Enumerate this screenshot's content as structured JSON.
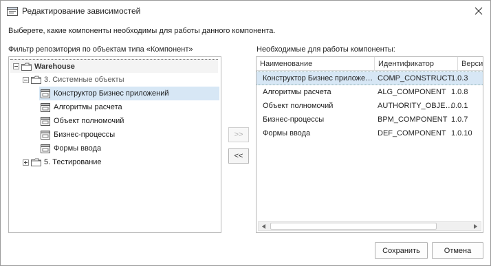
{
  "window": {
    "title": "Редактирование зависимостей",
    "instruction": "Выберете, какие компоненты необходимы для работы данного компонента."
  },
  "left_panel": {
    "label": "Фильтр репозитория по объектам типа «Компонент»",
    "tree": [
      {
        "label": "Warehouse",
        "kind": "root-folder",
        "expanded": true
      },
      {
        "label": "3. Системные объекты",
        "kind": "folder",
        "expanded": true
      },
      {
        "label": "Конструктор Бизнес приложений",
        "kind": "component",
        "selected": true
      },
      {
        "label": "Алгоритмы расчета",
        "kind": "component"
      },
      {
        "label": "Объект полномочий",
        "kind": "component"
      },
      {
        "label": "Бизнес-процессы",
        "kind": "component"
      },
      {
        "label": "Формы ввода",
        "kind": "component"
      },
      {
        "label": "5. Тестирование",
        "kind": "folder",
        "expanded": false
      }
    ]
  },
  "middle": {
    "add_label": ">>",
    "remove_label": "<<"
  },
  "right_panel": {
    "label": "Необходимые для работы компоненты:",
    "columns": [
      "Наименование",
      "Идентификатор",
      "Версия"
    ],
    "rows": [
      {
        "name": "Конструктор Бизнес приложений",
        "id": "COMP_CONSTRUCT",
        "version": "1.0.3",
        "selected": true
      },
      {
        "name": "Алгоритмы расчета",
        "id": "ALG_COMPONENT",
        "version": "1.0.8"
      },
      {
        "name": "Объект полномочий",
        "id": "AUTHORITY_OBJECT_COMPONENT",
        "version": "0.0.1"
      },
      {
        "name": "Бизнес-процессы",
        "id": "BPM_COMPONENT",
        "version": "1.0.7"
      },
      {
        "name": "Формы ввода",
        "id": "DEF_COMPONENT",
        "version": "1.0.10"
      }
    ]
  },
  "footer": {
    "save_label": "Сохранить",
    "cancel_label": "Отмена"
  },
  "icons": {
    "window": "dialog-window-icon",
    "close": "close-icon",
    "folder": "folder-icon",
    "component": "component-icon"
  },
  "colors": {
    "selection": "#d7e7f5",
    "border": "#b7b7b7"
  }
}
